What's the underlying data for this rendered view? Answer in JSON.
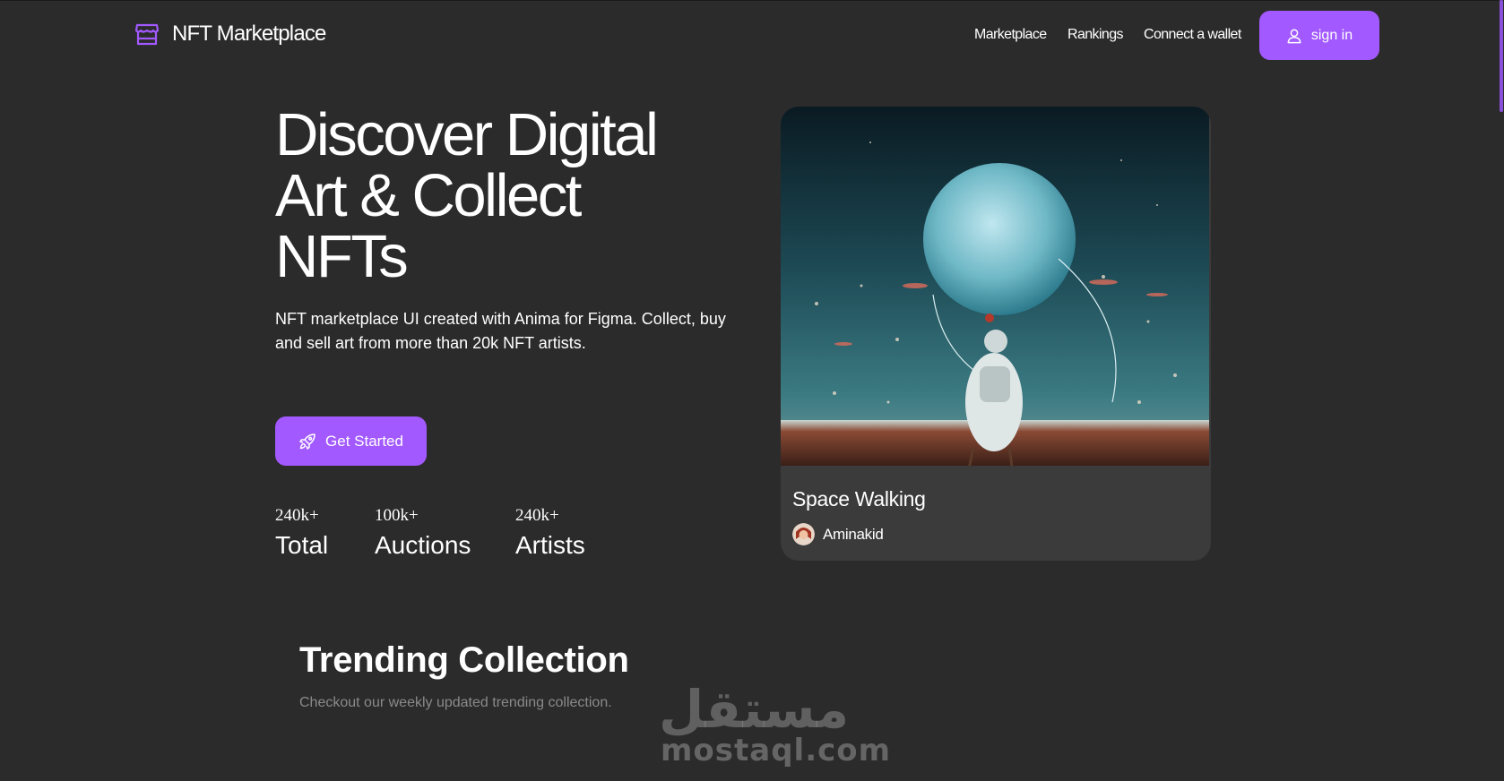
{
  "header": {
    "logo_icon": "storefront-icon",
    "brand": "NFT Marketplace",
    "nav": [
      "Marketplace",
      "Rankings",
      "Connect a wallet"
    ],
    "signin_icon": "user-icon",
    "signin_label": "sign in"
  },
  "hero": {
    "title": "Discover Digital Art & Collect NFTs",
    "subtitle": "NFT marketplace UI created with Anima for Figma. Collect, buy and sell art from more than 20k NFT artists.",
    "cta_icon": "rocket-icon",
    "cta_label": "Get Started",
    "stats": [
      {
        "value": "240k+",
        "label": "Total"
      },
      {
        "value": "100k+",
        "label": "Auctions"
      },
      {
        "value": "240k+",
        "label": "Artists"
      }
    ]
  },
  "card": {
    "title": "Space Walking",
    "artist": "Aminakid"
  },
  "trending": {
    "title": "Trending Collection",
    "subtitle": "Checkout our weekly updated trending collection."
  },
  "watermark": {
    "arabic": "مستقل",
    "latin": "mostaql.com"
  },
  "colors": {
    "background": "#2b2b2b",
    "accent": "#a259ff",
    "card": "#3b3b3b",
    "muted_text": "#8a8a8a"
  }
}
